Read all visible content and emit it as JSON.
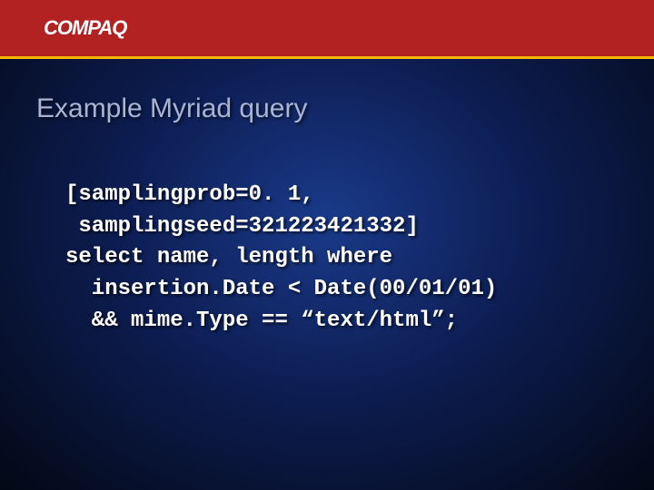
{
  "header": {
    "logo_text": "COMPAQ"
  },
  "slide": {
    "title": "Example Myriad query",
    "code_lines": [
      "[samplingprob=0. 1,",
      " samplingseed=321223421332]",
      "select name, length where",
      "  insertion.Date < Date(00/01/01)",
      "  && mime.Type == “text/html”;"
    ]
  }
}
